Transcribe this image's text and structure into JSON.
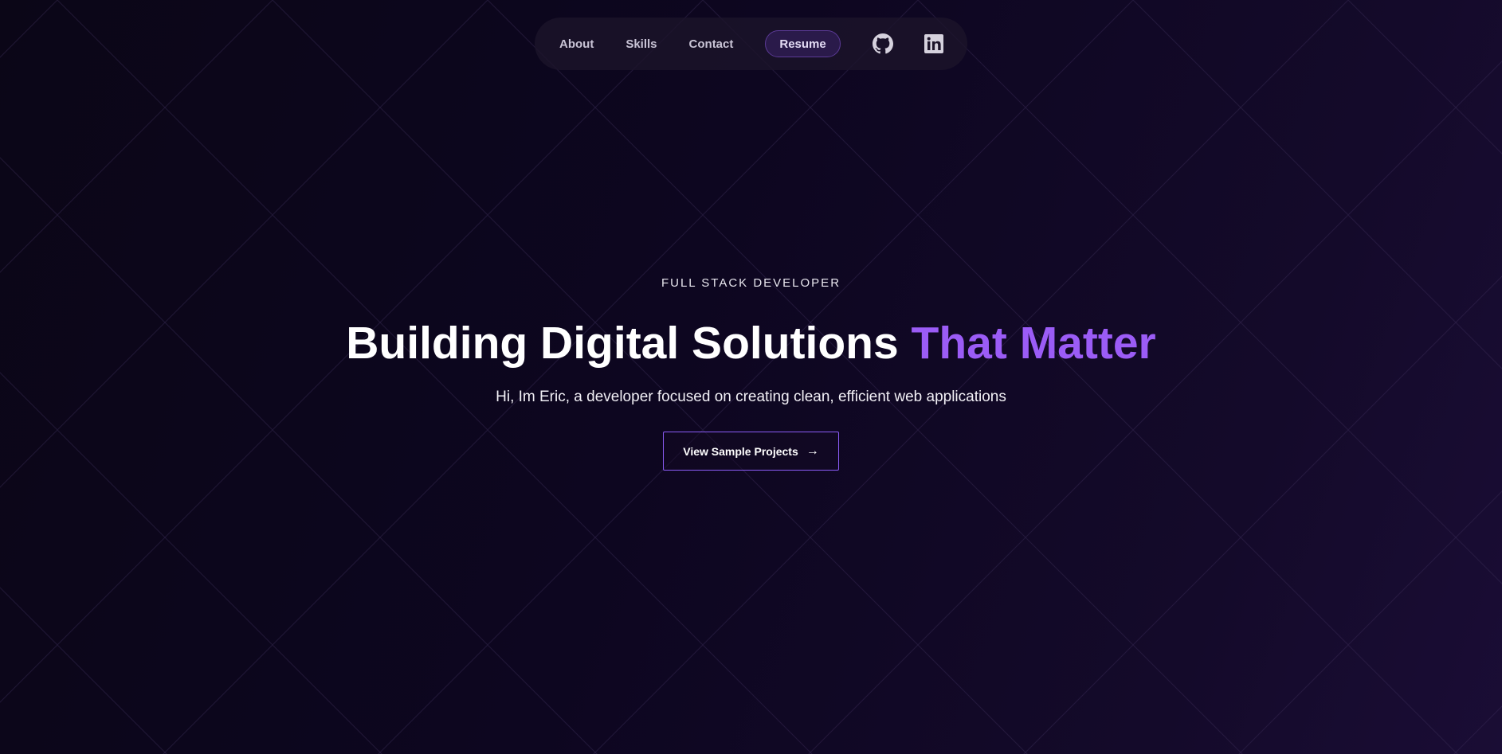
{
  "nav": {
    "links": [
      {
        "label": "About"
      },
      {
        "label": "Skills"
      },
      {
        "label": "Contact"
      }
    ],
    "resume_label": "Resume",
    "social": [
      {
        "icon": "github-icon"
      },
      {
        "icon": "linkedin-icon"
      }
    ]
  },
  "hero": {
    "eyebrow": "FULL STACK DEVELOPER",
    "headline_main": "Building Digital Solutions ",
    "headline_accent": "That Matter",
    "subtitle": "Hi, Im Eric, a developer focused on creating clean, efficient web applications",
    "cta_label": "View Sample Projects",
    "cta_arrow": "→"
  },
  "colors": {
    "background": "#0d0620",
    "accent": "#9b5cf6",
    "grid_line": "#3a2a56"
  }
}
